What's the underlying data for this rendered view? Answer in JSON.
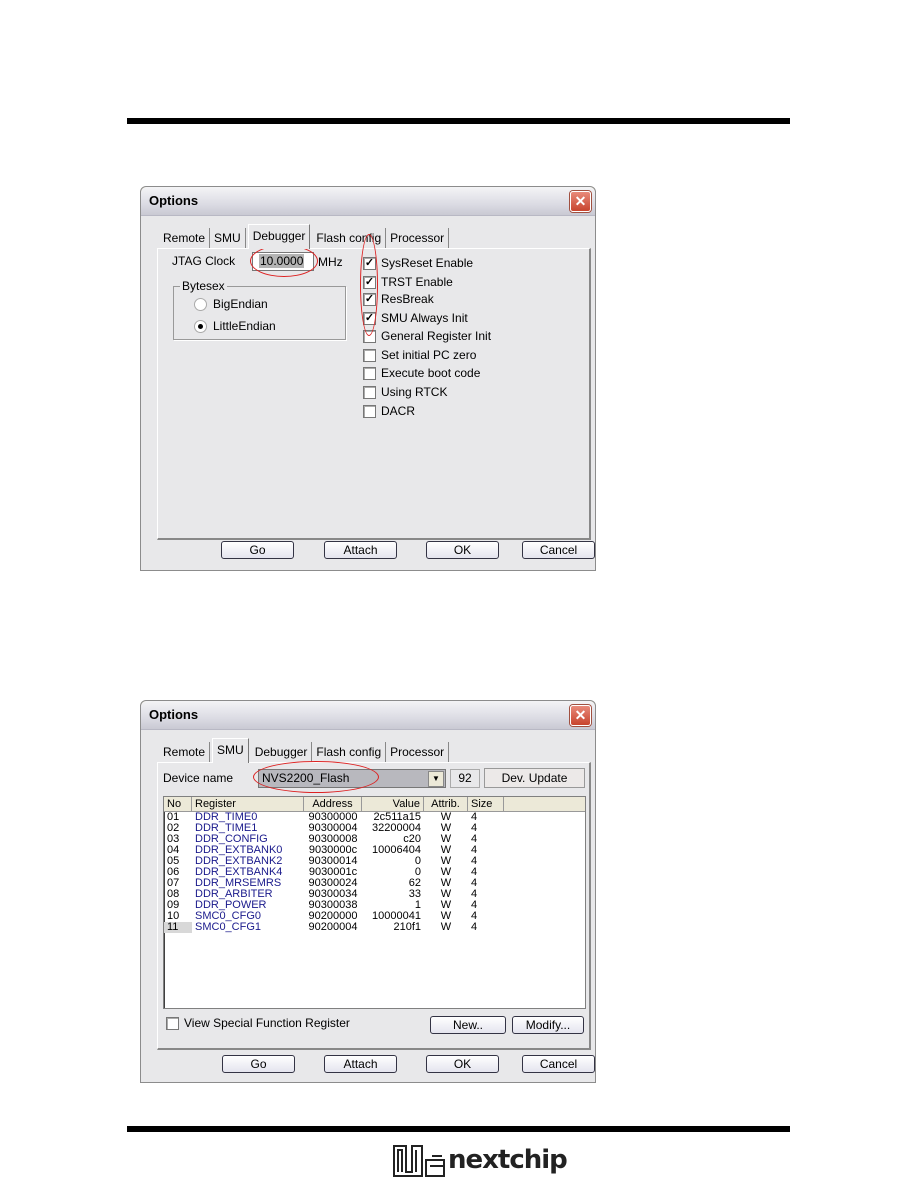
{
  "page": {
    "logo_text": "nextchip"
  },
  "dialog1": {
    "title": "Options",
    "tabs": [
      {
        "label": "Remote",
        "active": false
      },
      {
        "label": "SMU",
        "active": false
      },
      {
        "label": "Debugger",
        "active": true
      },
      {
        "label": "Flash config",
        "active": false
      },
      {
        "label": "Processor",
        "active": false
      }
    ],
    "jtag_label": "JTAG Clock",
    "jtag_value": "10.0000",
    "jtag_unit": "MHz",
    "bytesex_label": "Bytesex",
    "radios": [
      {
        "label": "BigEndian",
        "selected": false
      },
      {
        "label": "LittleEndian",
        "selected": true
      }
    ],
    "checkboxes": [
      {
        "label": "SysReset Enable",
        "checked": true
      },
      {
        "label": "TRST Enable",
        "checked": true
      },
      {
        "label": "ResBreak",
        "checked": true
      },
      {
        "label": "SMU Always Init",
        "checked": true
      },
      {
        "label": "General Register Init",
        "checked": false
      },
      {
        "label": "Set initial PC zero",
        "checked": false
      },
      {
        "label": "Execute boot code",
        "checked": false
      },
      {
        "label": "Using RTCK",
        "checked": false
      },
      {
        "label": "DACR",
        "checked": false
      }
    ],
    "buttons": {
      "go": "Go",
      "attach": "Attach",
      "ok": "OK",
      "cancel": "Cancel"
    }
  },
  "dialog2": {
    "title": "Options",
    "tabs": [
      {
        "label": "Remote",
        "active": false
      },
      {
        "label": "SMU",
        "active": true
      },
      {
        "label": "Debugger",
        "active": false
      },
      {
        "label": "Flash config",
        "active": false
      },
      {
        "label": "Processor",
        "active": false
      }
    ],
    "device_label": "Device name",
    "device_value": "NVS2200_Flash",
    "device_count": "92",
    "dev_update": "Dev. Update",
    "columns": [
      "No",
      "Register",
      "Address",
      "Value",
      "Attrib.",
      "Size"
    ],
    "rows": [
      {
        "no": "01",
        "register": "DDR_TIME0",
        "address": "90300000",
        "value": "2c511a15",
        "attrib": "W",
        "size": "4"
      },
      {
        "no": "02",
        "register": "DDR_TIME1",
        "address": "90300004",
        "value": "32200004",
        "attrib": "W",
        "size": "4"
      },
      {
        "no": "03",
        "register": "DDR_CONFIG",
        "address": "90300008",
        "value": "c20",
        "attrib": "W",
        "size": "4"
      },
      {
        "no": "04",
        "register": "DDR_EXTBANK0",
        "address": "9030000c",
        "value": "10006404",
        "attrib": "W",
        "size": "4"
      },
      {
        "no": "05",
        "register": "DDR_EXTBANK2",
        "address": "90300014",
        "value": "0",
        "attrib": "W",
        "size": "4"
      },
      {
        "no": "06",
        "register": "DDR_EXTBANK4",
        "address": "9030001c",
        "value": "0",
        "attrib": "W",
        "size": "4"
      },
      {
        "no": "07",
        "register": "DDR_MRSEMRS",
        "address": "90300024",
        "value": "62",
        "attrib": "W",
        "size": "4"
      },
      {
        "no": "08",
        "register": "DDR_ARBITER",
        "address": "90300034",
        "value": "33",
        "attrib": "W",
        "size": "4"
      },
      {
        "no": "09",
        "register": "DDR_POWER",
        "address": "90300038",
        "value": "1",
        "attrib": "W",
        "size": "4"
      },
      {
        "no": "10",
        "register": "SMC0_CFG0",
        "address": "90200000",
        "value": "10000041",
        "attrib": "W",
        "size": "4"
      },
      {
        "no": "11",
        "register": "SMC0_CFG1",
        "address": "90200004",
        "value": "210f1",
        "attrib": "W",
        "size": "4"
      }
    ],
    "sfr_label": "View Special Function Register",
    "sfr_checked": false,
    "new_button": "New..",
    "modify_button": "Modify...",
    "buttons": {
      "go": "Go",
      "attach": "Attach",
      "ok": "OK",
      "cancel": "Cancel"
    }
  }
}
